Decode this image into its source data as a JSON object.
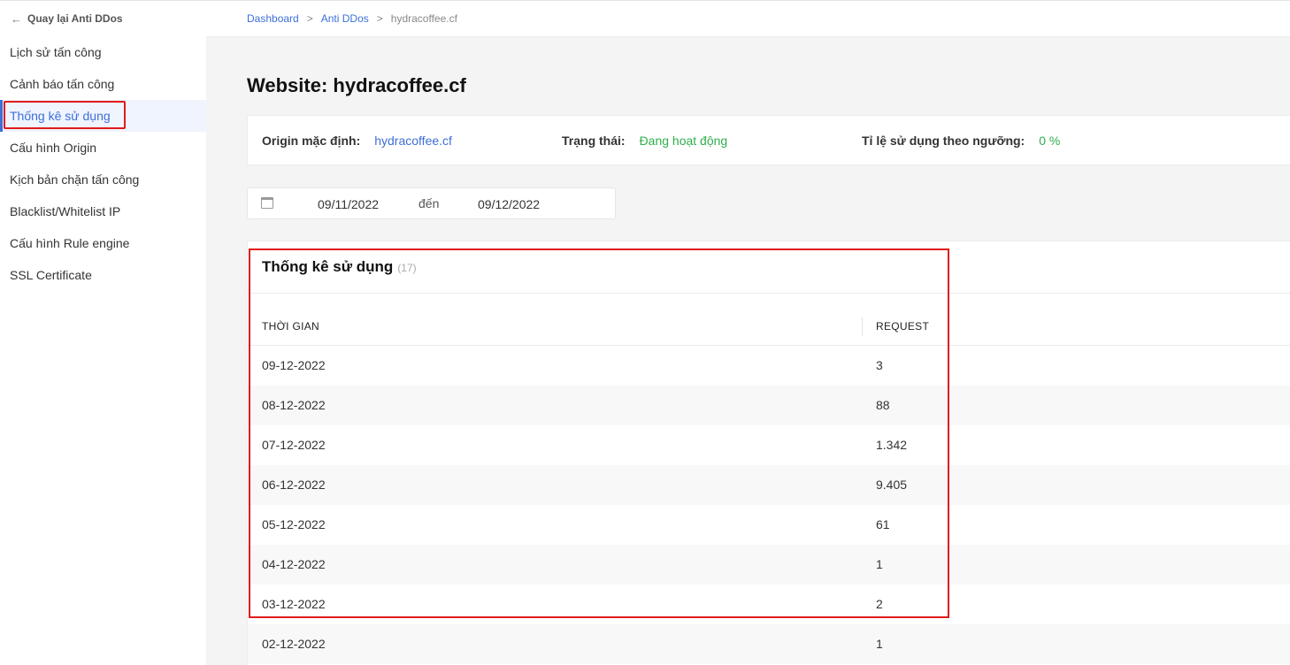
{
  "sidebar": {
    "back_label": "Quay lại Anti DDos",
    "items": [
      {
        "label": "Lịch sử tấn công"
      },
      {
        "label": "Cảnh báo tấn công"
      },
      {
        "label": "Thống kê sử dụng"
      },
      {
        "label": "Cấu hình Origin"
      },
      {
        "label": "Kịch bản chặn tấn công"
      },
      {
        "label": "Blacklist/Whitelist IP"
      },
      {
        "label": "Cấu hình Rule engine"
      },
      {
        "label": "SSL Certificate"
      }
    ]
  },
  "breadcrumb": {
    "items": [
      "Dashboard",
      "Anti DDos",
      "hydracoffee.cf"
    ],
    "separator": ">"
  },
  "page": {
    "title": "Website: hydracoffee.cf"
  },
  "info": {
    "origin_label": "Origin mặc định:",
    "origin_value": "hydracoffee.cf",
    "status_label": "Trạng thái:",
    "status_value": "Đang hoạt động",
    "ratio_label": "Tỉ lệ sử dụng theo ngưỡng:",
    "ratio_value": "0 %"
  },
  "date_range": {
    "from": "09/11/2022",
    "to_label": "đến",
    "to": "09/12/2022"
  },
  "stats": {
    "title": "Thống kê sử dụng",
    "count": "(17)",
    "columns": [
      "THỜI GIAN",
      "REQUEST"
    ],
    "rows": [
      {
        "time": "09-12-2022",
        "request": "3"
      },
      {
        "time": "08-12-2022",
        "request": "88"
      },
      {
        "time": "07-12-2022",
        "request": "1.342"
      },
      {
        "time": "06-12-2022",
        "request": "9.405"
      },
      {
        "time": "05-12-2022",
        "request": "61"
      },
      {
        "time": "04-12-2022",
        "request": "1"
      },
      {
        "time": "03-12-2022",
        "request": "2"
      },
      {
        "time": "02-12-2022",
        "request": "1"
      }
    ]
  },
  "colors": {
    "accent": "#3d6fd8",
    "success": "#2fae4d",
    "highlight": "#e01b1b"
  }
}
